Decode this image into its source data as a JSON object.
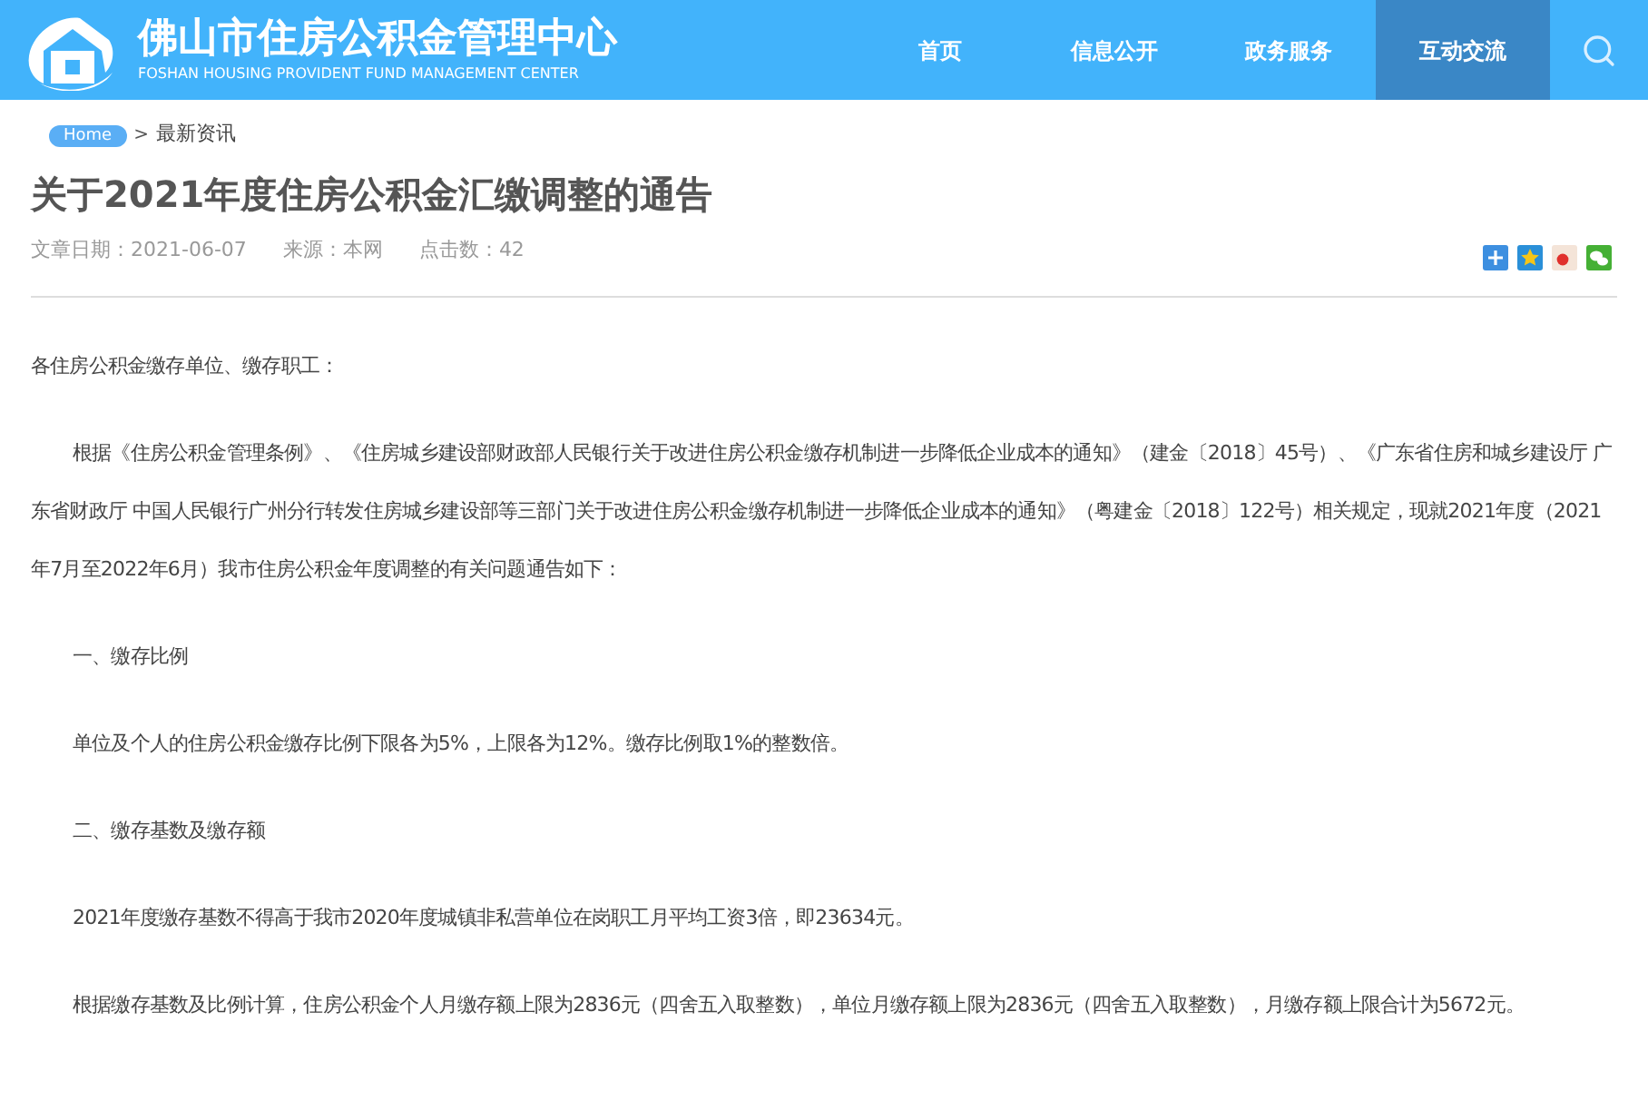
{
  "header": {
    "title": "佛山市住房公积金管理中心",
    "subtitle": "FOSHAN HOUSING PROVIDENT FUND MANAGEMENT CENTER"
  },
  "nav": [
    {
      "label": "首页",
      "selected": false
    },
    {
      "label": "信息公开",
      "selected": false
    },
    {
      "label": "政务服务",
      "selected": false
    },
    {
      "label": "互动交流",
      "selected": true
    }
  ],
  "breadcrumb": {
    "home": "Home",
    "separator": ">",
    "current": "最新资讯"
  },
  "article": {
    "title": "关于2021年度住房公积金汇缴调整的通告",
    "meta": [
      "文章日期：2021-06-07",
      "来源：本网",
      "点击数：42"
    ],
    "paragraphs": [
      {
        "kind": "plain",
        "text": "各住房公积金缴存单位、缴存职工："
      },
      {
        "kind": "indent",
        "text": "根据《住房公积金管理条例》、《住房城乡建设部财政部人民银行关于改进住房公积金缴存机制进一步降低企业成本的通知》（建金〔2018〕45号）、《广东省住房和城乡建设厅 广东省财政厅 中国人民银行广州分行转发住房城乡建设部等三部门关于改进住房公积金缴存机制进一步降低企业成本的通知》（粤建金〔2018〕122号）相关规定，现就2021年度（2021年7月至2022年6月）我市住房公积金年度调整的有关问题通告如下："
      },
      {
        "kind": "indent",
        "text": "一、缴存比例"
      },
      {
        "kind": "indent",
        "text": "单位及个人的住房公积金缴存比例下限各为5%，上限各为12%。缴存比例取1%的整数倍。"
      },
      {
        "kind": "indent",
        "text": "二、缴存基数及缴存额"
      },
      {
        "kind": "indent",
        "text": "2021年度缴存基数不得高于我市2020年度城镇非私营单位在岗职工月平均工资3倍，即23634元。"
      },
      {
        "kind": "indent",
        "text": "根据缴存基数及比例计算，住房公积金个人月缴存额上限为2836元（四舍五入取整数），单位月缴存额上限为2836元（四舍五入取整数），月缴存额上限合计为5672元。"
      }
    ]
  }
}
